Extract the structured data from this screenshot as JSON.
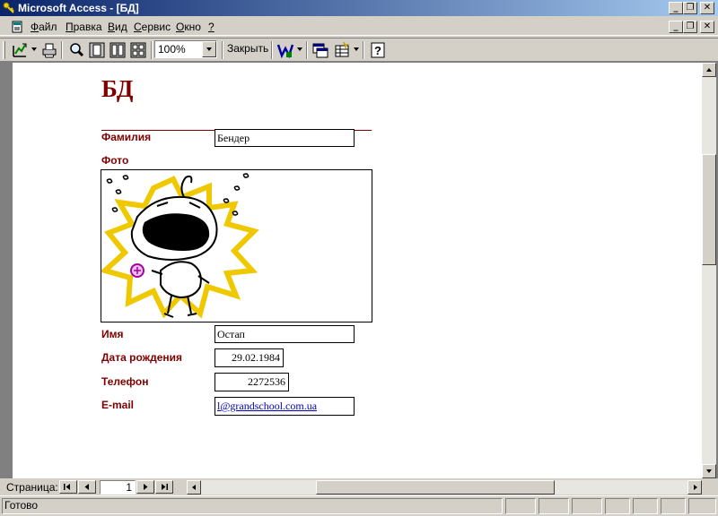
{
  "window": {
    "title": "Microsoft Access - [БД]",
    "controls": [
      "_",
      "❐",
      "✕"
    ]
  },
  "menu": {
    "items": [
      {
        "label": "Файл"
      },
      {
        "label": "Правка"
      },
      {
        "label": "Вид"
      },
      {
        "label": "Сервис"
      },
      {
        "label": "Окно"
      },
      {
        "label": "?"
      }
    ],
    "doc_controls": [
      "_",
      "❐",
      "✕"
    ]
  },
  "toolbar": {
    "zoom_value": "100%",
    "close_label": "Закрыть",
    "icons": [
      "view-design-icon",
      "print-icon",
      "zoom-icon",
      "one-page-icon",
      "two-pages-icon",
      "multiple-pages-icon",
      "office-links-icon",
      "database-window-icon",
      "new-object-icon",
      "help-icon"
    ]
  },
  "report": {
    "title": "БД",
    "fields": {
      "surname": {
        "label": "Фамилия",
        "value": "Бендер"
      },
      "photo": {
        "label": "Фото"
      },
      "name": {
        "label": "Имя",
        "value": "Остап"
      },
      "birthdate": {
        "label": "Дата рождения",
        "value": "29.02.1984"
      },
      "phone": {
        "label": "Телефон",
        "value": "2272536"
      },
      "email": {
        "label": "E-mail",
        "value": "l@grandschool.com.ua"
      }
    },
    "colors": {
      "label": "#800000",
      "link": "#0000c0"
    }
  },
  "navigation": {
    "label": "Страница:",
    "page_number": "1"
  },
  "status": {
    "text": "Готово"
  }
}
